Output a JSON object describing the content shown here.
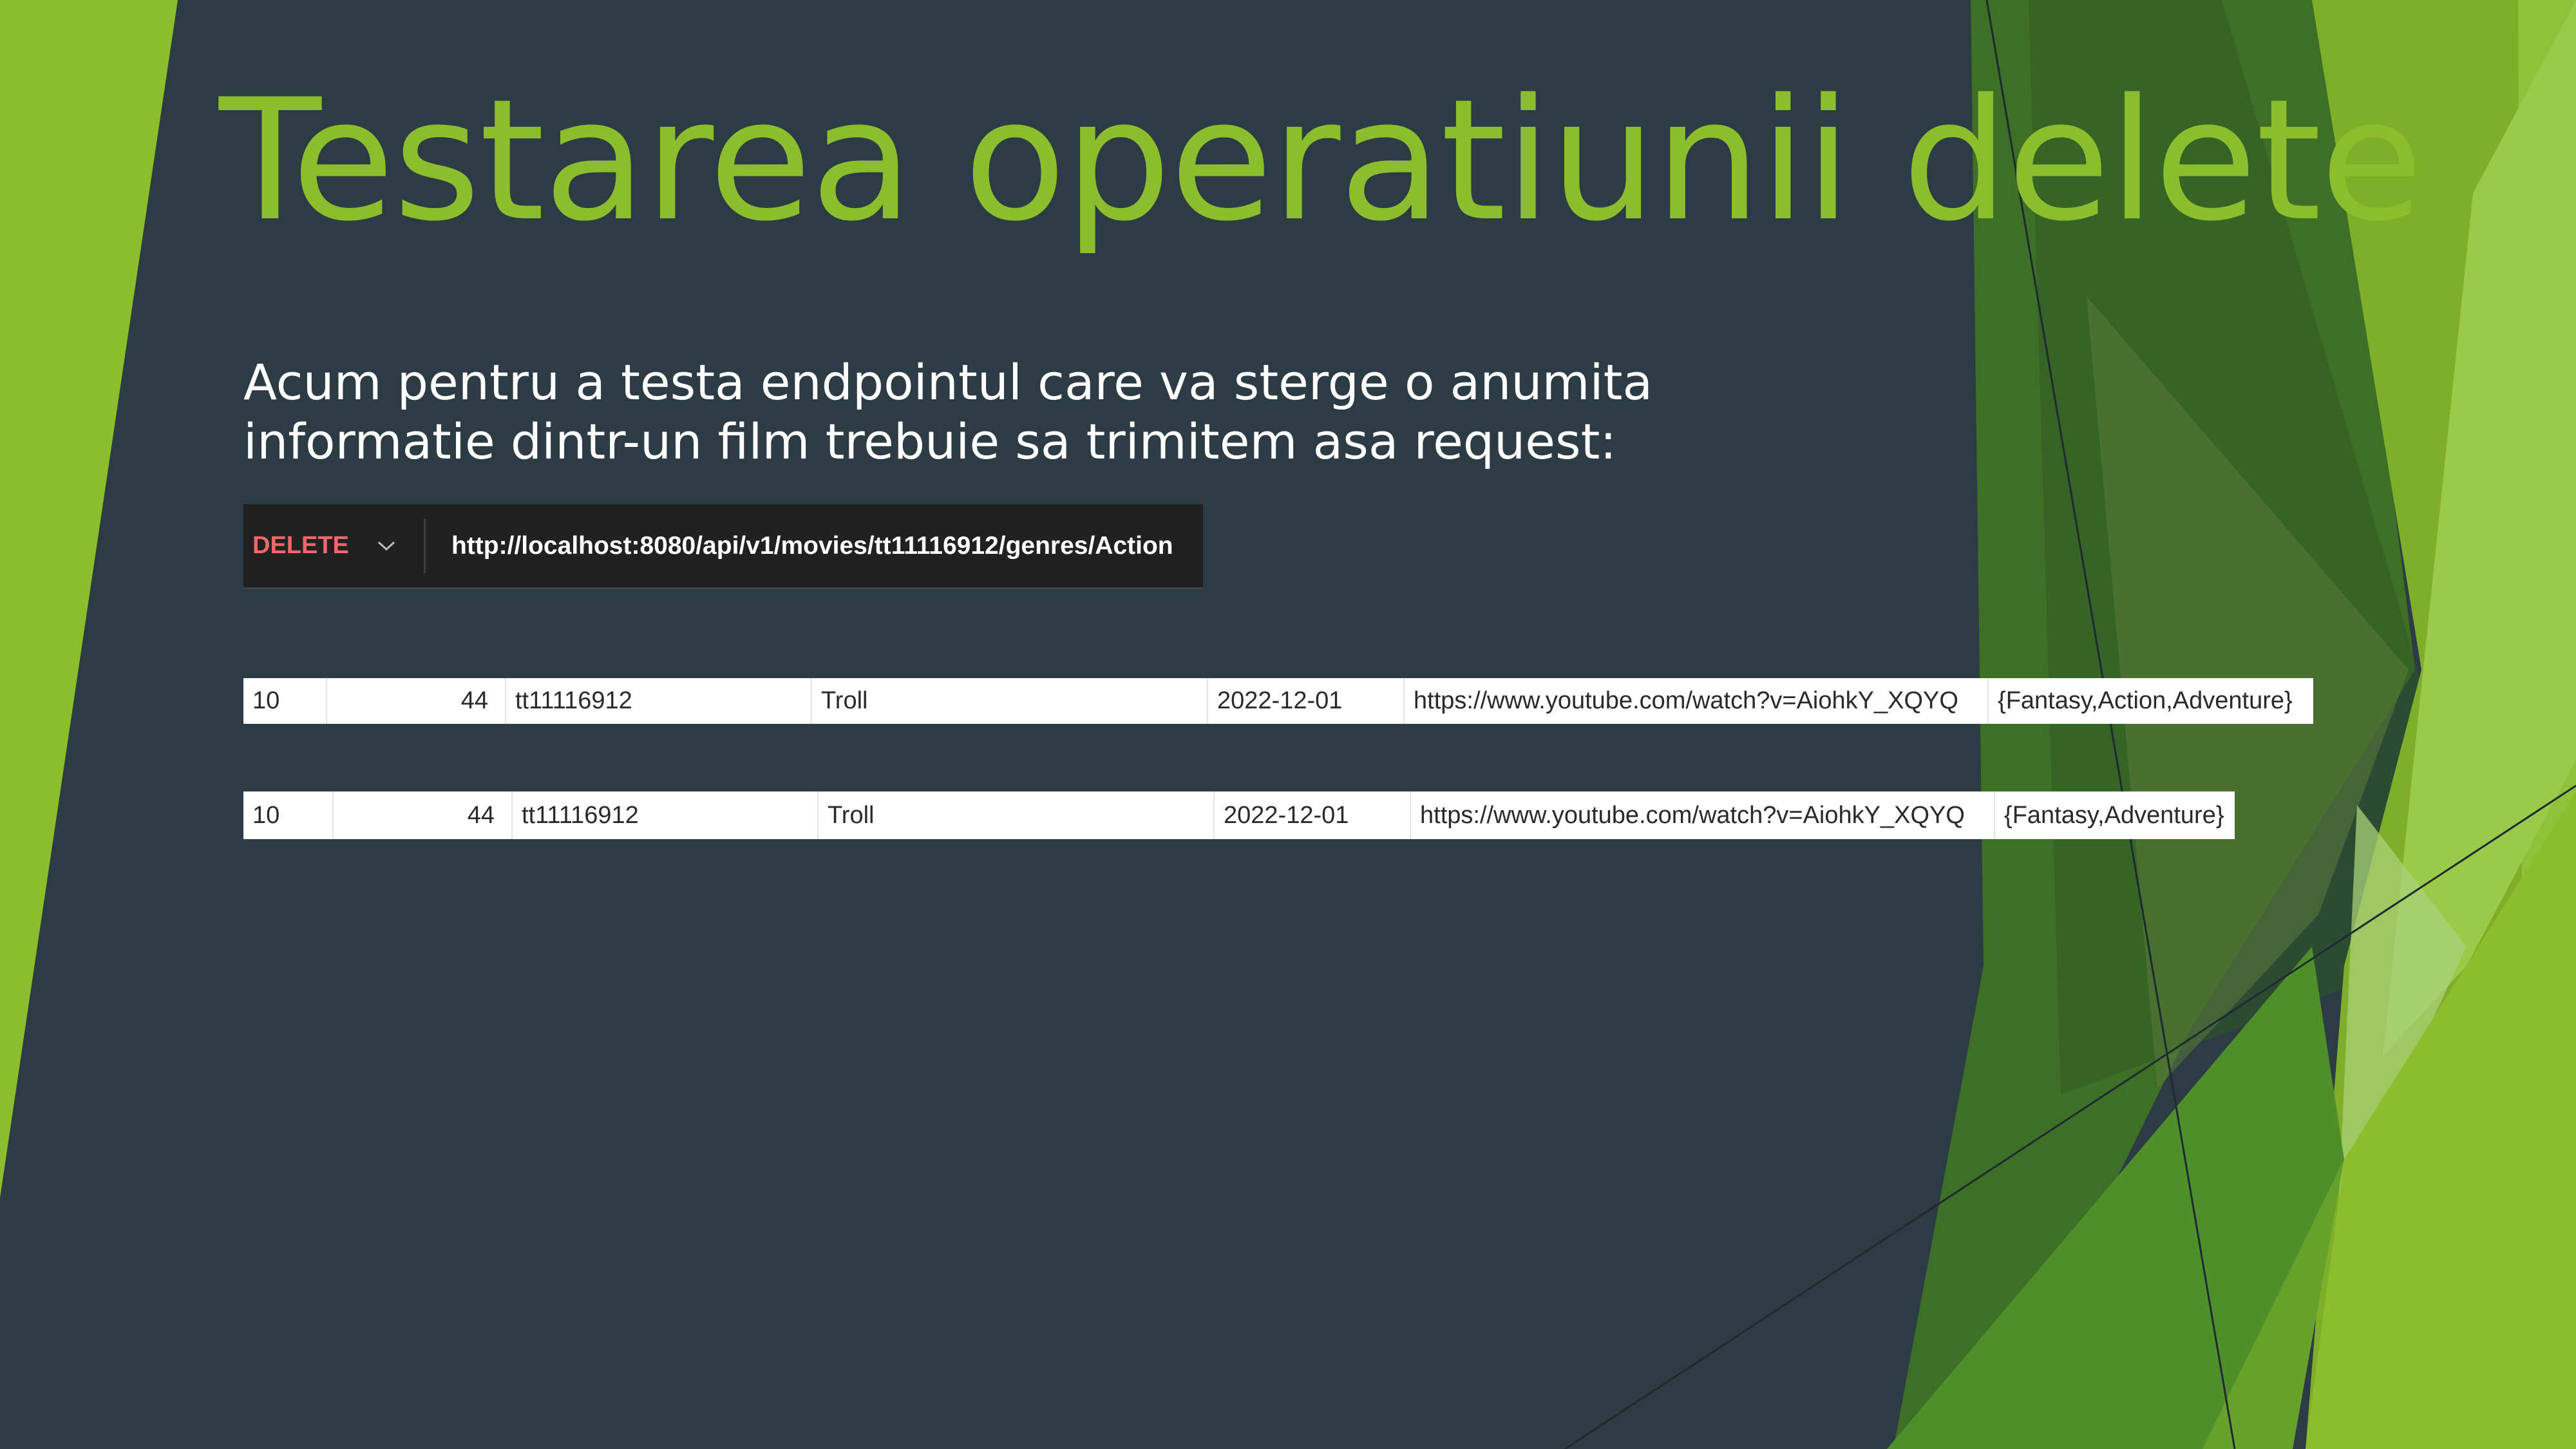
{
  "slide": {
    "title": "Testarea operatiunii delete",
    "text_lines": [
      "Acum pentru a testa endpointul care va sterge o anumita",
      "informatie dintr-un film trebuie sa trimitem asa request:"
    ]
  },
  "request": {
    "method": "DELETE",
    "url": "http://localhost:8080/api/v1/movies/tt11116912/genres/Action"
  },
  "rows": [
    {
      "id": "10",
      "num": "44",
      "imdb_id": "tt11116912",
      "title": "Troll",
      "date": "2022-12-01",
      "trailer": "https://www.youtube.com/watch?v=AiohkY_XQYQ",
      "genres": "{Fantasy,Action,Adventure}"
    },
    {
      "id": "10",
      "num": "44",
      "imdb_id": "tt11116912",
      "title": "Troll",
      "date": "2022-12-01",
      "trailer": "https://www.youtube.com/watch?v=AiohkY_XQYQ",
      "genres": "{Fantasy,Adventure}"
    }
  ],
  "colors": {
    "background": "#2c3b44",
    "title": "#8cbd2d",
    "method": "#f1676a",
    "accent_green": "#8cbd2d"
  }
}
